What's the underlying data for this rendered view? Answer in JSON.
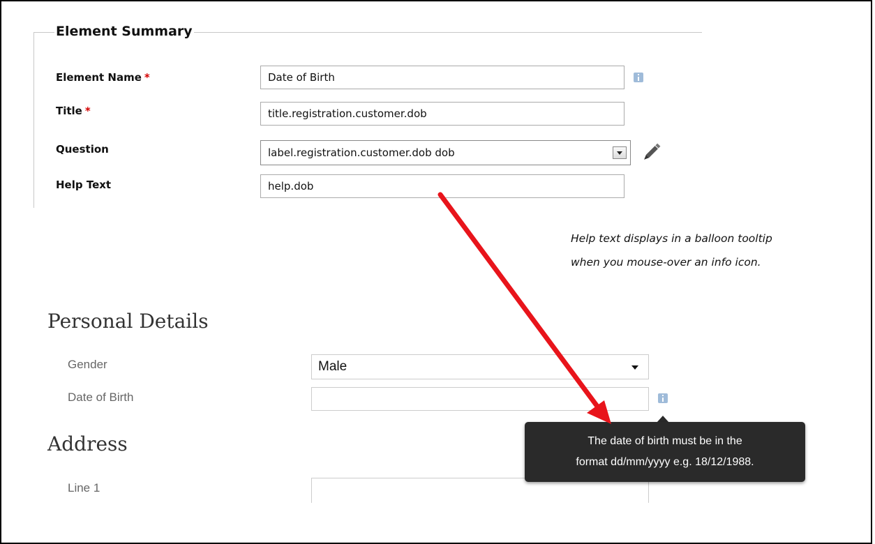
{
  "element_summary": {
    "legend": "Element Summary",
    "fields": {
      "element_name": {
        "label": "Element Name",
        "required_mark": "*",
        "value": "Date of Birth"
      },
      "title": {
        "label": "Title",
        "required_mark": "*",
        "value": "title.registration.customer.dob"
      },
      "question": {
        "label": "Question",
        "value": "label.registration.customer.dob dob"
      },
      "help_text": {
        "label": "Help Text",
        "value": "help.dob"
      }
    },
    "icons": {
      "element_name_info": "info-icon",
      "question_edit": "pencil-icon",
      "question_dropdown": "chevron-down-icon"
    }
  },
  "annotation": {
    "line1": "Help text displays in a balloon tooltip",
    "line2": "when you mouse-over an info icon.",
    "arrow_color": "#e8141b"
  },
  "personal_details": {
    "heading": "Personal Details",
    "gender": {
      "label": "Gender",
      "value": "Male"
    },
    "date_of_birth": {
      "label": "Date of Birth",
      "value": ""
    }
  },
  "tooltip": {
    "line1": "The date of birth must be in the",
    "line2": "format dd/mm/yyyy e.g. 18/12/1988."
  },
  "address": {
    "heading": "Address",
    "line1": {
      "label": "Line 1",
      "value": ""
    }
  },
  "colors": {
    "required": "#d40000",
    "info_icon": "#9fbbd9",
    "tooltip_bg": "#2a2a2a"
  }
}
